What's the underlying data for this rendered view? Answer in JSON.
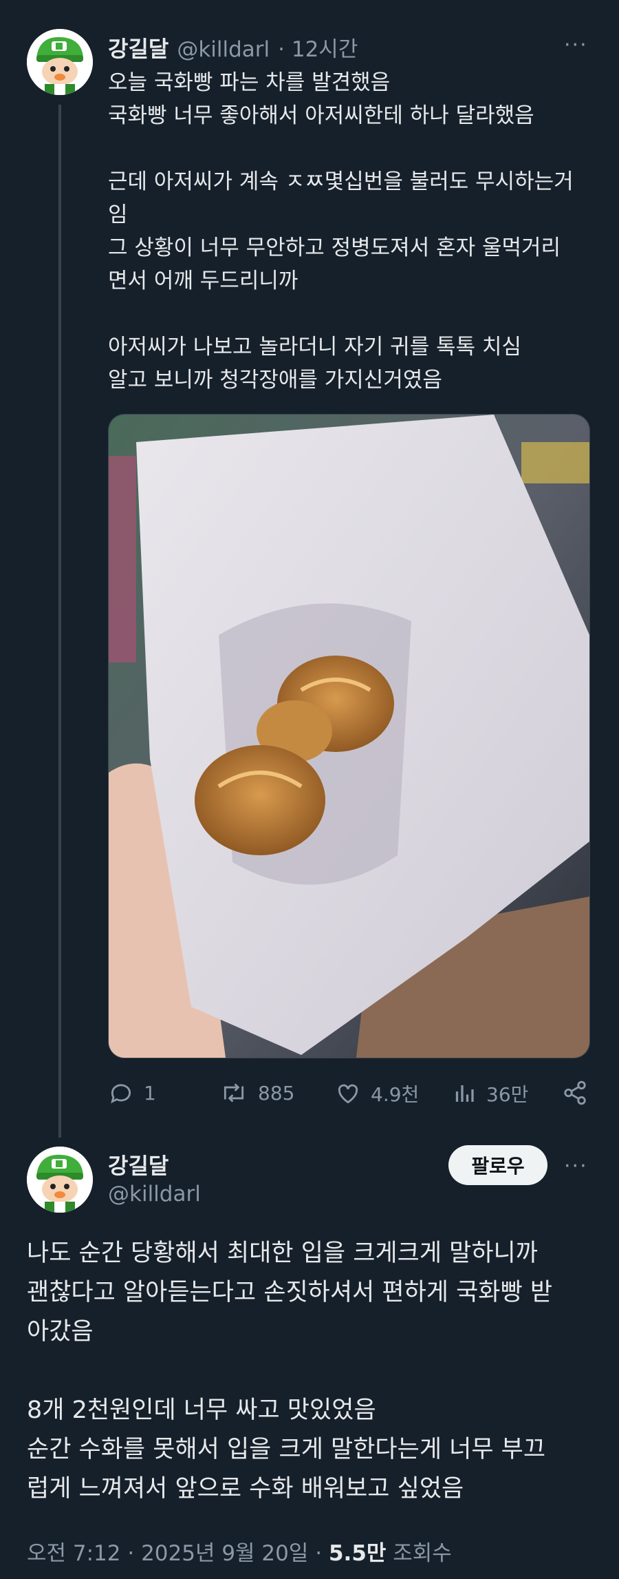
{
  "tweet": {
    "name": "강길달",
    "handle": "@killdarl",
    "time": "· 12시간",
    "text": "오늘 국화빵 파는 차를 발견했음\n국화빵 너무 좋아해서 아저씨한테 하나 달라했음\n\n근데 아저씨가 계속 ㅈㅉ몇십번을 불러도 무시하는거\n임\n그 상황이 너무 무안하고 정병도져서 혼자 울먹거리\n면서 어깨 두드리니까\n\n아저씨가 나보고 놀라더니 자기 귀를 톡톡 치심\n알고 보니까 청각장애를 가지신거였음",
    "more": "···",
    "actions": {
      "replies": "1",
      "retweets": "885",
      "likes": "4.9천",
      "views": "36만"
    }
  },
  "reply": {
    "name": "강길달",
    "handle": "@killdarl",
    "follow_label": "팔로우",
    "more": "···",
    "text": "나도 순간 당황해서 최대한 입을 크게크게 말하니까\n괜찮다고 알아듣는다고 손짓하셔서 편하게 국화빵 받\n아갔음\n\n8개 2천원인데 너무 싸고 맛있었음\n순간 수화를 못해서 입을 크게 말한다는게 너무 부끄\n럽게 느껴져서 앞으로 수화 배워보고 싶었음",
    "meta_time": "오전 7:12 · 2025년 9월 20일 · ",
    "meta_views": "5.5만",
    "meta_views_label": " 조회수"
  },
  "colors": {
    "background": "#15202b",
    "text": "#e7e9ea",
    "secondary": "#8b98a5"
  }
}
